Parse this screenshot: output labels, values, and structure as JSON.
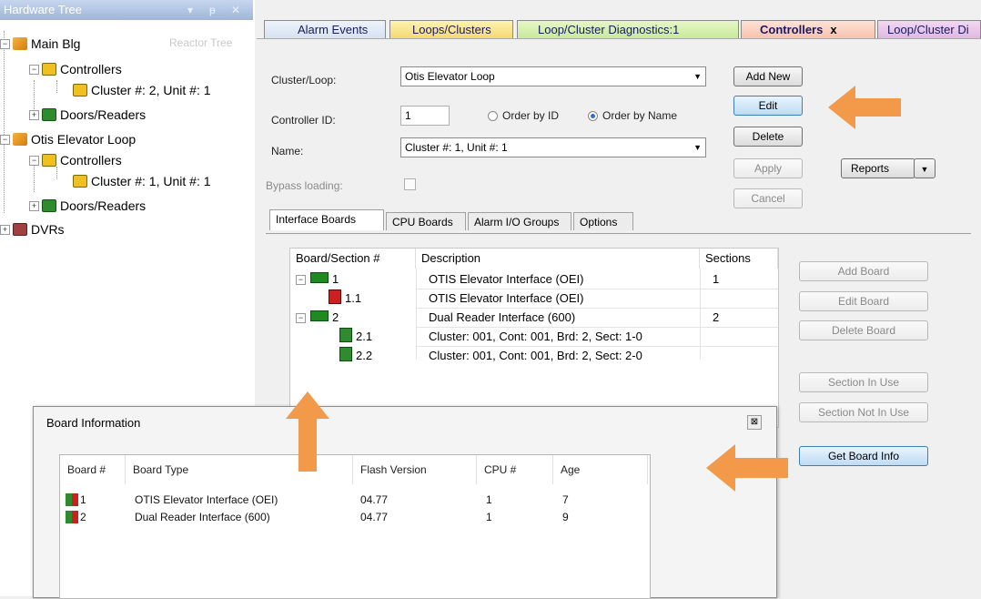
{
  "hardware_tree": {
    "title": "Hardware Tree",
    "controls": [
      "▾",
      "ᵽ",
      "✕"
    ],
    "faded_header": "Reactor Tree",
    "nodes": [
      {
        "label": "Main Blg"
      },
      {
        "label": "Controllers"
      },
      {
        "label": "Cluster #: 2, Unit #: 1"
      },
      {
        "label": "Doors/Readers"
      },
      {
        "label": "Otis Elevator Loop"
      },
      {
        "label": "Controllers"
      },
      {
        "label": "Cluster #: 1, Unit #: 1"
      },
      {
        "label": "Doors/Readers"
      },
      {
        "label": "DVRs"
      }
    ]
  },
  "tabs": [
    {
      "label": "Alarm Events"
    },
    {
      "label": "Loops/Clusters"
    },
    {
      "label": "Loop/Cluster Diagnostics:1"
    },
    {
      "label": "Controllers",
      "close": "x"
    },
    {
      "label": "Loop/Cluster Di"
    }
  ],
  "form": {
    "cluster_label": "Cluster/Loop:",
    "cluster_value": "Otis Elevator Loop",
    "controller_id_label": "Controller ID:",
    "controller_id_value": "1",
    "order_by_id": "Order by ID",
    "order_by_name": "Order by Name",
    "name_label": "Name:",
    "name_value": "Cluster #: 1, Unit #: 1",
    "bypass_label": "Bypass loading:"
  },
  "buttons": {
    "add_new": "Add New",
    "edit": "Edit",
    "delete": "Delete",
    "apply": "Apply",
    "cancel": "Cancel",
    "reports": "Reports",
    "add_board": "Add Board",
    "edit_board": "Edit Board",
    "delete_board": "Delete Board",
    "section_in_use": "Section In Use",
    "section_not_in_use": "Section Not In Use",
    "get_board_info": "Get Board Info"
  },
  "subtabs": [
    {
      "label": "Interface Boards"
    },
    {
      "label": "CPU Boards"
    },
    {
      "label": "Alarm I/O Groups"
    },
    {
      "label": "Options"
    }
  ],
  "board_list": {
    "headers": [
      "Board/Section #",
      "Description",
      "Sections"
    ],
    "rows": [
      {
        "num": "1",
        "desc": "OTIS Elevator Interface (OEI)",
        "sections": "1"
      },
      {
        "num": "1.1",
        "desc": "OTIS Elevator Interface (OEI)",
        "sections": ""
      },
      {
        "num": "2",
        "desc": "Dual Reader Interface (600)",
        "sections": "2"
      },
      {
        "num": "2.1",
        "desc": "Cluster: 001, Cont: 001, Brd: 2, Sect: 1-0",
        "sections": ""
      },
      {
        "num": "2.2",
        "desc": "Cluster: 001, Cont: 001, Brd: 2, Sect: 2-0",
        "sections": ""
      }
    ]
  },
  "dialog": {
    "title": "Board Information",
    "close": "⊠",
    "headers": [
      "Board #",
      "Board Type",
      "Flash Version",
      "CPU #",
      "Age"
    ],
    "rows": [
      {
        "board": "1",
        "type": "OTIS Elevator Interface (OEI)",
        "flash": "04.77",
        "cpu": "1",
        "age": "7"
      },
      {
        "board": "2",
        "type": "Dual Reader Interface (600)",
        "flash": "04.77",
        "cpu": "1",
        "age": "9"
      }
    ]
  },
  "colors": {
    "arrow": "#f29a4a",
    "accent_blue": "#2a6fd8"
  }
}
